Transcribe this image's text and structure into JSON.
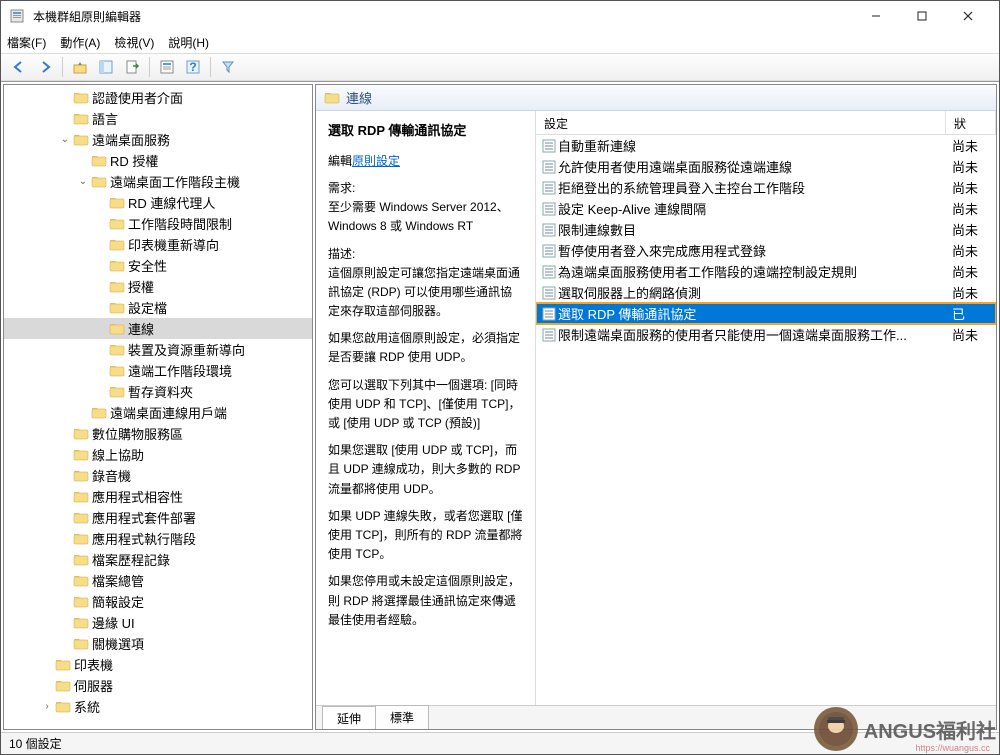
{
  "window_title": "本機群組原則編輯器",
  "menu": {
    "file": "檔案(F)",
    "action": "動作(A)",
    "view": "檢視(V)",
    "help": "說明(H)"
  },
  "tree": [
    {
      "depth": 3,
      "exp": "",
      "label": "認證使用者介面"
    },
    {
      "depth": 3,
      "exp": "",
      "label": "語言"
    },
    {
      "depth": 3,
      "exp": "v",
      "label": "遠端桌面服務"
    },
    {
      "depth": 4,
      "exp": "",
      "label": "RD 授權"
    },
    {
      "depth": 4,
      "exp": "v",
      "label": "遠端桌面工作階段主機"
    },
    {
      "depth": 5,
      "exp": "",
      "label": "RD 連線代理人"
    },
    {
      "depth": 5,
      "exp": "",
      "label": "工作階段時間限制"
    },
    {
      "depth": 5,
      "exp": "",
      "label": "印表機重新導向"
    },
    {
      "depth": 5,
      "exp": "",
      "label": "安全性"
    },
    {
      "depth": 5,
      "exp": "",
      "label": "授權"
    },
    {
      "depth": 5,
      "exp": "",
      "label": "設定檔"
    },
    {
      "depth": 5,
      "exp": "",
      "label": "連線",
      "selected": true
    },
    {
      "depth": 5,
      "exp": "",
      "label": "裝置及資源重新導向"
    },
    {
      "depth": 5,
      "exp": "",
      "label": "遠端工作階段環境"
    },
    {
      "depth": 5,
      "exp": "",
      "label": "暫存資料夾"
    },
    {
      "depth": 4,
      "exp": "",
      "label": "遠端桌面連線用戶端"
    },
    {
      "depth": 3,
      "exp": "",
      "label": "數位購物服務區"
    },
    {
      "depth": 3,
      "exp": "",
      "label": "線上協助"
    },
    {
      "depth": 3,
      "exp": "",
      "label": "錄音機"
    },
    {
      "depth": 3,
      "exp": "",
      "label": "應用程式相容性"
    },
    {
      "depth": 3,
      "exp": "",
      "label": "應用程式套件部署"
    },
    {
      "depth": 3,
      "exp": "",
      "label": "應用程式執行階段"
    },
    {
      "depth": 3,
      "exp": "",
      "label": "檔案歷程記錄"
    },
    {
      "depth": 3,
      "exp": "",
      "label": "檔案總管"
    },
    {
      "depth": 3,
      "exp": "",
      "label": "簡報設定"
    },
    {
      "depth": 3,
      "exp": "",
      "label": "邊緣 UI"
    },
    {
      "depth": 3,
      "exp": "",
      "label": "關機選項"
    },
    {
      "depth": 2,
      "exp": "",
      "label": "印表機"
    },
    {
      "depth": 2,
      "exp": "",
      "label": "伺服器"
    },
    {
      "depth": 2,
      "exp": ">",
      "label": "系統"
    }
  ],
  "detail_header": "連線",
  "detail_title": "選取 RDP 傳輸通訊協定",
  "detail_edit": "編輯",
  "detail_edit_link": "原則設定",
  "detail_req_label": "需求:",
  "detail_req_text": "至少需要 Windows Server 2012、Windows 8 或 Windows RT",
  "detail_desc_label": "描述:",
  "detail_desc_1": "這個原則設定可讓您指定遠端桌面通訊協定 (RDP) 可以使用哪些通訊協定來存取這部伺服器。",
  "detail_desc_2": "如果您啟用這個原則設定，必須指定是否要讓 RDP 使用 UDP。",
  "detail_desc_3": "您可以選取下列其中一個選項: [同時使用 UDP 和 TCP]、[僅使用 TCP]，或 [使用 UDP 或 TCP (預設)]",
  "detail_desc_4": "如果您選取 [使用 UDP 或 TCP]，而且 UDP 連線成功，則大多數的 RDP 流量都將使用 UDP。",
  "detail_desc_5": "如果 UDP 連線失敗，或者您選取 [僅使用 TCP]，則所有的 RDP 流量都將使用 TCP。",
  "detail_desc_6": "如果您停用或未設定這個原則設定，則 RDP 將選擇最佳通訊協定來傳遞最佳使用者經驗。",
  "list_cols": {
    "setting": "設定",
    "state": "狀"
  },
  "list": [
    {
      "name": "自動重新連線",
      "state": "尚未"
    },
    {
      "name": "允許使用者使用遠端桌面服務從遠端連線",
      "state": "尚未"
    },
    {
      "name": "拒絕登出的系統管理員登入主控台工作階段",
      "state": "尚未"
    },
    {
      "name": "設定 Keep-Alive 連線間隔",
      "state": "尚未"
    },
    {
      "name": "限制連線數目",
      "state": "尚未"
    },
    {
      "name": "暫停使用者登入來完成應用程式登錄",
      "state": "尚未"
    },
    {
      "name": "為遠端桌面服務使用者工作階段的遠端控制設定規則",
      "state": "尚未"
    },
    {
      "name": "選取伺服器上的網路偵測",
      "state": "尚未"
    },
    {
      "name": "選取 RDP 傳輸通訊協定",
      "state": "已",
      "selected": true
    },
    {
      "name": "限制遠端桌面服務的使用者只能使用一個遠端桌面服務工作...",
      "state": "尚未"
    }
  ],
  "tabs": {
    "extended": "延伸",
    "standard": "標準"
  },
  "statusbar": "10 個設定",
  "watermark": {
    "main": "ANGUS福利社",
    "sub": "https://wuangus.cc"
  }
}
